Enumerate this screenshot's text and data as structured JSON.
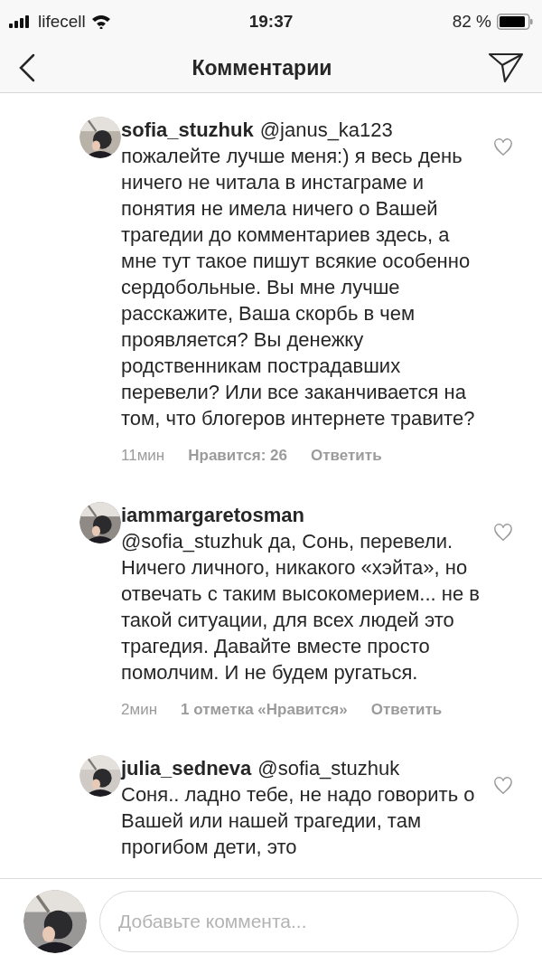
{
  "status_bar": {
    "carrier": "lifecell",
    "time": "19:37",
    "battery": "82 %"
  },
  "header": {
    "title": "Комментарии"
  },
  "comments": [
    {
      "username": "sofia_stuzhuk",
      "mention": "@janus_ka123",
      "text": "пожалейте лучше меня:) я весь день ничего не читала в инстаграме и понятия не имела ничего о Вашей трагедии до комментариев здесь, а мне тут такое пишут всякие особенно сердобольные. Вы мне лучше расскажите, Ваша скорбь в чем проявляется? Вы денежку родственникам пострадавших перевели? Или все заканчивается на том, что блогеров интернете травите?",
      "time": "11мин",
      "likes": "Нравится: 26",
      "reply": "Ответить"
    },
    {
      "username": "iammargaretosman",
      "text": "@sofia_stuzhuk да, Сонь, перевели. Ничего личного, никакого «хэйта», но отвечать с таким высокомерием... не в такой ситуации, для всех людей это трагедия. Давайте вместе просто помолчим. И не будем ругаться.",
      "time": "2мин",
      "likes": "1 отметка «Нравится»",
      "reply": "Ответить"
    },
    {
      "username": "julia_sedneva",
      "mention": "@sofia_stuzhuk",
      "text": "Соня.. ладно тебе, не надо говорить о Вашей или нашей трагедии, там прогибом дети, это"
    }
  ],
  "composer": {
    "placeholder": "Добавьте коммента..."
  }
}
